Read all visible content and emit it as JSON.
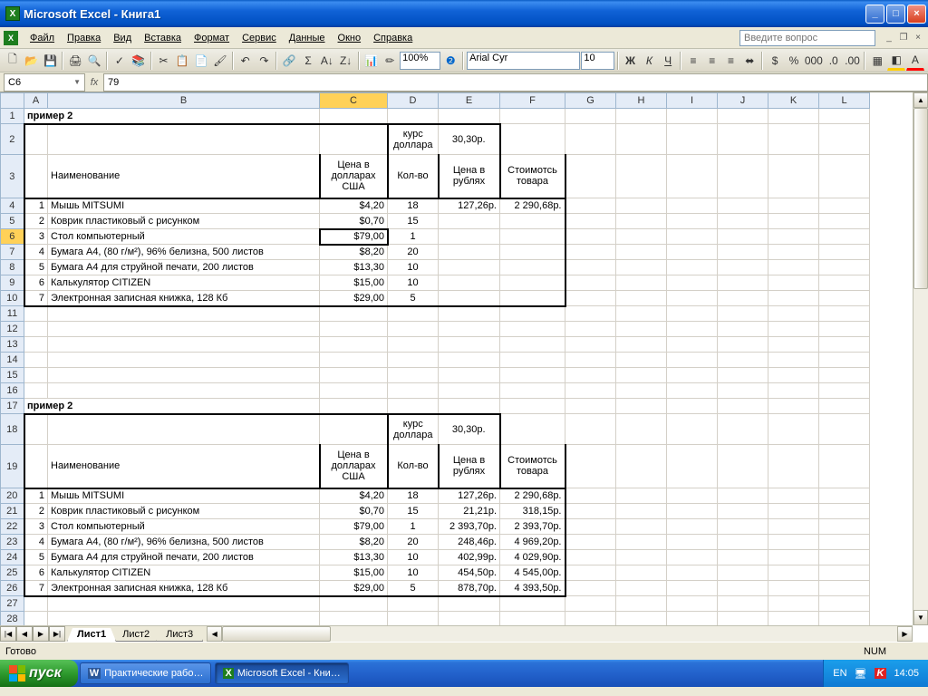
{
  "title": "Microsoft Excel - Книга1",
  "menu": [
    "Файл",
    "Правка",
    "Вид",
    "Вставка",
    "Формат",
    "Сервис",
    "Данные",
    "Окно",
    "Справка"
  ],
  "question_placeholder": "Введите вопрос",
  "font_name": "Arial Cyr",
  "font_size": "10",
  "zoom": "100%",
  "namebox": "C6",
  "formula": "79",
  "columns": [
    "A",
    "B",
    "C",
    "D",
    "E",
    "F",
    "G",
    "H",
    "I",
    "J",
    "K",
    "L"
  ],
  "headers": {
    "title": "пример 2",
    "kurs_label": "курс доллара",
    "kurs_val": "30,30р.",
    "name": "Наименование",
    "price_usd": "Цена в долларах США",
    "qty": "Кол-во",
    "price_rub": "Цена в рублях",
    "total": "Стоимотсь товара"
  },
  "table1": [
    {
      "n": "1",
      "name": "Мышь MITSUMI",
      "usd": "$4,20",
      "qty": "18",
      "rub": "127,26р.",
      "tot": "2 290,68р."
    },
    {
      "n": "2",
      "name": "Коврик пластиковый с рисунком",
      "usd": "$0,70",
      "qty": "15",
      "rub": "",
      "tot": ""
    },
    {
      "n": "3",
      "name": "Стол компьютерный",
      "usd": "$79,00",
      "qty": "1",
      "rub": "",
      "tot": ""
    },
    {
      "n": "4",
      "name": "Бумага А4, (80 г/м²), 96% белизна, 500 листов",
      "usd": "$8,20",
      "qty": "20",
      "rub": "",
      "tot": ""
    },
    {
      "n": "5",
      "name": "Бумага А4 для струйной печати, 200 листов",
      "usd": "$13,30",
      "qty": "10",
      "rub": "",
      "tot": ""
    },
    {
      "n": "6",
      "name": "Калькулятор CITIZEN",
      "usd": "$15,00",
      "qty": "10",
      "rub": "",
      "tot": ""
    },
    {
      "n": "7",
      "name": "Электронная записная книжка, 128 Кб",
      "usd": "$29,00",
      "qty": "5",
      "rub": "",
      "tot": ""
    }
  ],
  "table2": [
    {
      "n": "1",
      "name": "Мышь MITSUMI",
      "usd": "$4,20",
      "qty": "18",
      "rub": "127,26р.",
      "tot": "2 290,68р."
    },
    {
      "n": "2",
      "name": "Коврик пластиковый с рисунком",
      "usd": "$0,70",
      "qty": "15",
      "rub": "21,21р.",
      "tot": "318,15р."
    },
    {
      "n": "3",
      "name": "Стол компьютерный",
      "usd": "$79,00",
      "qty": "1",
      "rub": "2 393,70р.",
      "tot": "2 393,70р."
    },
    {
      "n": "4",
      "name": "Бумага А4, (80 г/м²), 96% белизна, 500 листов",
      "usd": "$8,20",
      "qty": "20",
      "rub": "248,46р.",
      "tot": "4 969,20р."
    },
    {
      "n": "5",
      "name": "Бумага А4 для струйной печати, 200 листов",
      "usd": "$13,30",
      "qty": "10",
      "rub": "402,99р.",
      "tot": "4 029,90р."
    },
    {
      "n": "6",
      "name": "Калькулятор CITIZEN",
      "usd": "$15,00",
      "qty": "10",
      "rub": "454,50р.",
      "tot": "4 545,00р."
    },
    {
      "n": "7",
      "name": "Электронная записная книжка, 128 Кб",
      "usd": "$29,00",
      "qty": "5",
      "rub": "878,70р.",
      "tot": "4 393,50р."
    }
  ],
  "sheet_tabs": [
    "Лист1",
    "Лист2",
    "Лист3"
  ],
  "status": "Готово",
  "status_right": "NUM",
  "start": "пуск",
  "task1": "Практические рабо…",
  "task2": "Microsoft Excel - Кни…",
  "tray_lang": "EN",
  "tray_time": "14:05"
}
